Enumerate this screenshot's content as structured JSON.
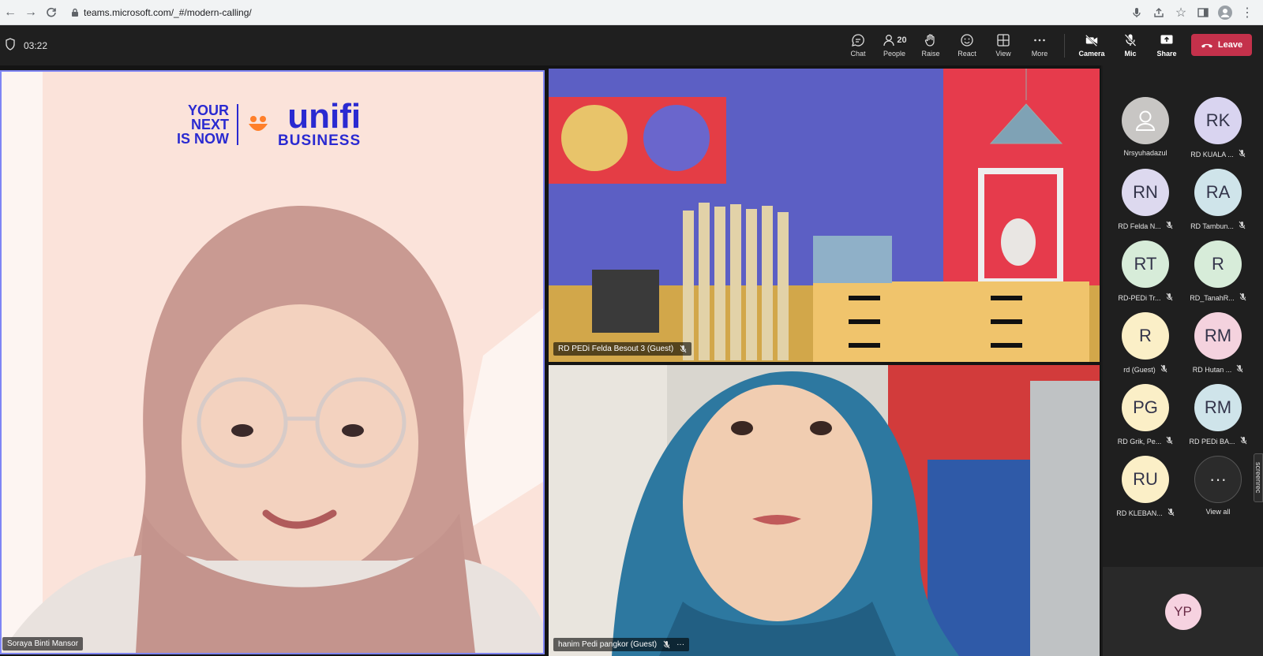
{
  "browser": {
    "url": "teams.microsoft.com/_#/modern-calling/"
  },
  "meeting": {
    "timer": "03:22",
    "controls": {
      "chat": "Chat",
      "people": "People",
      "people_count": "20",
      "raise": "Raise",
      "react": "React",
      "view": "View",
      "more": "More",
      "camera": "Camera",
      "mic": "Mic",
      "share": "Share",
      "leave": "Leave"
    }
  },
  "stage": {
    "main_tile": {
      "name": "Soraya Binti Mansor",
      "logo_tagline": [
        "YOUR",
        "NEXT",
        "IS NOW"
      ],
      "logo_brand": "unifi",
      "logo_sub": "BUSINESS"
    },
    "top_right_tile": {
      "name": "RD PEDi Felda Besout 3 (Guest)"
    },
    "bottom_right_tile": {
      "name": "hanim Pedi pangkor (Guest)"
    }
  },
  "roster": {
    "participants": [
      {
        "initials": "",
        "name": "Nrsyuhadazul",
        "muted": false,
        "color": "#c8c6c4",
        "icon": "person-icon"
      },
      {
        "initials": "RK",
        "name": "RD KUALA ...",
        "muted": true,
        "color": "#d9d4f0"
      },
      {
        "initials": "RN",
        "name": "RD Felda N...",
        "muted": true,
        "color": "#ddd9ef"
      },
      {
        "initials": "RA",
        "name": "RD Tambun...",
        "muted": true,
        "color": "#cfe4ea"
      },
      {
        "initials": "RT",
        "name": "RD-PEDi Tr...",
        "muted": true,
        "color": "#d7ecd9"
      },
      {
        "initials": "R",
        "name": "RD_TanahR...",
        "muted": true,
        "color": "#d7ecd9"
      },
      {
        "initials": "R",
        "name": "rd (Guest)",
        "muted": true,
        "color": "#fbefc7"
      },
      {
        "initials": "RM",
        "name": "RD Hutan ...",
        "muted": true,
        "color": "#f4d2de"
      },
      {
        "initials": "PG",
        "name": "RD Grik, Pe...",
        "muted": true,
        "color": "#fbefc7"
      },
      {
        "initials": "RM",
        "name": "RD PEDi BA...",
        "muted": true,
        "color": "#cfe4ea"
      },
      {
        "initials": "RU",
        "name": "RD KLEBAN...",
        "muted": true,
        "color": "#fbefc7"
      },
      {
        "initials": "···",
        "name": "View all",
        "muted": false,
        "color": "#2b2b2b"
      }
    ],
    "self_view": {
      "initials": "YP"
    }
  },
  "overlay": {
    "screenrec": "screenrec"
  },
  "colors": {
    "leave": "#c4314b",
    "active_border": "#7f85f5",
    "brand": "#2a2ad1"
  }
}
